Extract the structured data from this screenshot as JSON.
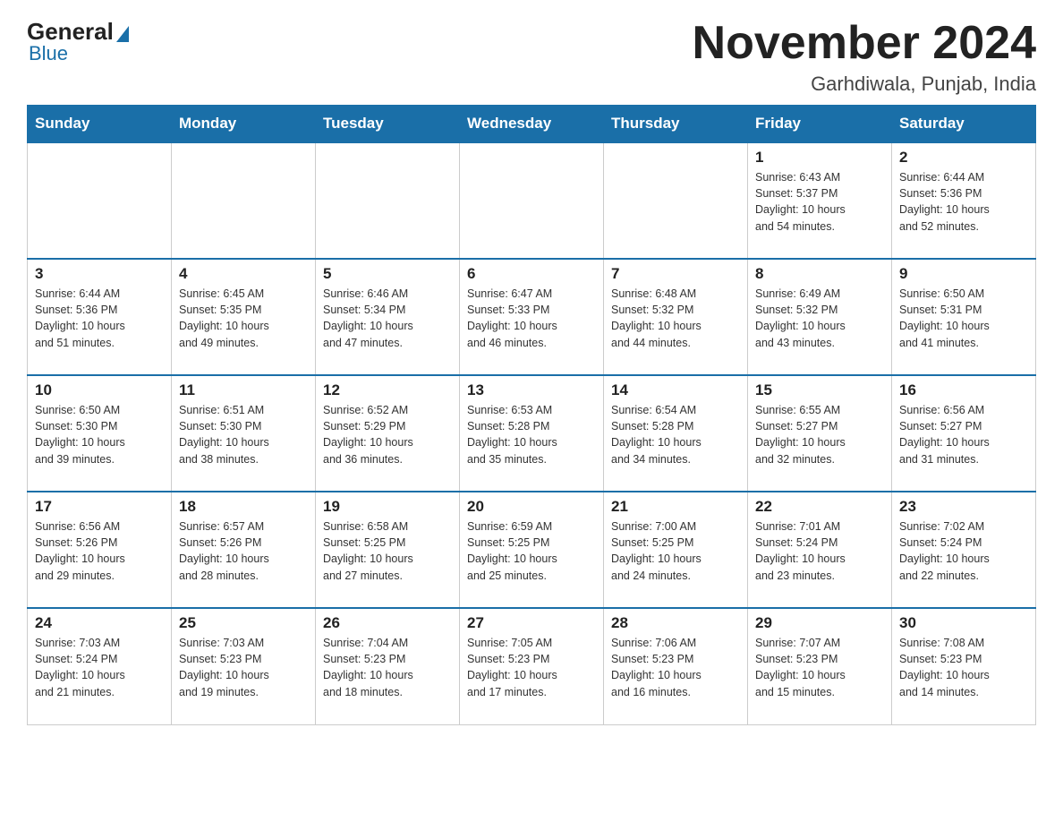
{
  "logo": {
    "general": "General",
    "blue": "Blue",
    "sub": "Blue"
  },
  "title": "November 2024",
  "subtitle": "Garhdiwala, Punjab, India",
  "weekdays": [
    "Sunday",
    "Monday",
    "Tuesday",
    "Wednesday",
    "Thursday",
    "Friday",
    "Saturday"
  ],
  "weeks": [
    [
      {
        "day": "",
        "info": ""
      },
      {
        "day": "",
        "info": ""
      },
      {
        "day": "",
        "info": ""
      },
      {
        "day": "",
        "info": ""
      },
      {
        "day": "",
        "info": ""
      },
      {
        "day": "1",
        "info": "Sunrise: 6:43 AM\nSunset: 5:37 PM\nDaylight: 10 hours\nand 54 minutes."
      },
      {
        "day": "2",
        "info": "Sunrise: 6:44 AM\nSunset: 5:36 PM\nDaylight: 10 hours\nand 52 minutes."
      }
    ],
    [
      {
        "day": "3",
        "info": "Sunrise: 6:44 AM\nSunset: 5:36 PM\nDaylight: 10 hours\nand 51 minutes."
      },
      {
        "day": "4",
        "info": "Sunrise: 6:45 AM\nSunset: 5:35 PM\nDaylight: 10 hours\nand 49 minutes."
      },
      {
        "day": "5",
        "info": "Sunrise: 6:46 AM\nSunset: 5:34 PM\nDaylight: 10 hours\nand 47 minutes."
      },
      {
        "day": "6",
        "info": "Sunrise: 6:47 AM\nSunset: 5:33 PM\nDaylight: 10 hours\nand 46 minutes."
      },
      {
        "day": "7",
        "info": "Sunrise: 6:48 AM\nSunset: 5:32 PM\nDaylight: 10 hours\nand 44 minutes."
      },
      {
        "day": "8",
        "info": "Sunrise: 6:49 AM\nSunset: 5:32 PM\nDaylight: 10 hours\nand 43 minutes."
      },
      {
        "day": "9",
        "info": "Sunrise: 6:50 AM\nSunset: 5:31 PM\nDaylight: 10 hours\nand 41 minutes."
      }
    ],
    [
      {
        "day": "10",
        "info": "Sunrise: 6:50 AM\nSunset: 5:30 PM\nDaylight: 10 hours\nand 39 minutes."
      },
      {
        "day": "11",
        "info": "Sunrise: 6:51 AM\nSunset: 5:30 PM\nDaylight: 10 hours\nand 38 minutes."
      },
      {
        "day": "12",
        "info": "Sunrise: 6:52 AM\nSunset: 5:29 PM\nDaylight: 10 hours\nand 36 minutes."
      },
      {
        "day": "13",
        "info": "Sunrise: 6:53 AM\nSunset: 5:28 PM\nDaylight: 10 hours\nand 35 minutes."
      },
      {
        "day": "14",
        "info": "Sunrise: 6:54 AM\nSunset: 5:28 PM\nDaylight: 10 hours\nand 34 minutes."
      },
      {
        "day": "15",
        "info": "Sunrise: 6:55 AM\nSunset: 5:27 PM\nDaylight: 10 hours\nand 32 minutes."
      },
      {
        "day": "16",
        "info": "Sunrise: 6:56 AM\nSunset: 5:27 PM\nDaylight: 10 hours\nand 31 minutes."
      }
    ],
    [
      {
        "day": "17",
        "info": "Sunrise: 6:56 AM\nSunset: 5:26 PM\nDaylight: 10 hours\nand 29 minutes."
      },
      {
        "day": "18",
        "info": "Sunrise: 6:57 AM\nSunset: 5:26 PM\nDaylight: 10 hours\nand 28 minutes."
      },
      {
        "day": "19",
        "info": "Sunrise: 6:58 AM\nSunset: 5:25 PM\nDaylight: 10 hours\nand 27 minutes."
      },
      {
        "day": "20",
        "info": "Sunrise: 6:59 AM\nSunset: 5:25 PM\nDaylight: 10 hours\nand 25 minutes."
      },
      {
        "day": "21",
        "info": "Sunrise: 7:00 AM\nSunset: 5:25 PM\nDaylight: 10 hours\nand 24 minutes."
      },
      {
        "day": "22",
        "info": "Sunrise: 7:01 AM\nSunset: 5:24 PM\nDaylight: 10 hours\nand 23 minutes."
      },
      {
        "day": "23",
        "info": "Sunrise: 7:02 AM\nSunset: 5:24 PM\nDaylight: 10 hours\nand 22 minutes."
      }
    ],
    [
      {
        "day": "24",
        "info": "Sunrise: 7:03 AM\nSunset: 5:24 PM\nDaylight: 10 hours\nand 21 minutes."
      },
      {
        "day": "25",
        "info": "Sunrise: 7:03 AM\nSunset: 5:23 PM\nDaylight: 10 hours\nand 19 minutes."
      },
      {
        "day": "26",
        "info": "Sunrise: 7:04 AM\nSunset: 5:23 PM\nDaylight: 10 hours\nand 18 minutes."
      },
      {
        "day": "27",
        "info": "Sunrise: 7:05 AM\nSunset: 5:23 PM\nDaylight: 10 hours\nand 17 minutes."
      },
      {
        "day": "28",
        "info": "Sunrise: 7:06 AM\nSunset: 5:23 PM\nDaylight: 10 hours\nand 16 minutes."
      },
      {
        "day": "29",
        "info": "Sunrise: 7:07 AM\nSunset: 5:23 PM\nDaylight: 10 hours\nand 15 minutes."
      },
      {
        "day": "30",
        "info": "Sunrise: 7:08 AM\nSunset: 5:23 PM\nDaylight: 10 hours\nand 14 minutes."
      }
    ]
  ]
}
